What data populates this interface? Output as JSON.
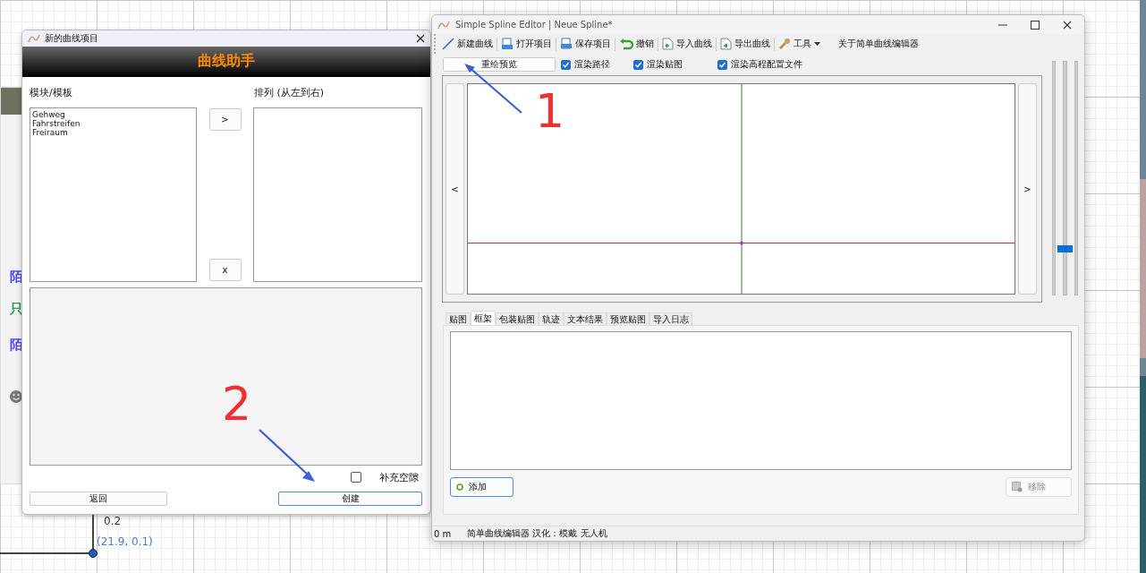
{
  "desktop": {
    "side_texts": [
      {
        "text": "陌",
        "color": "#4545f5"
      },
      {
        "text": "只",
        "color": "#2e9b5a"
      },
      {
        "text": "陌",
        "color": "#4545f5"
      }
    ],
    "axis_label": "0.2",
    "point_label": "(21.9, 0.1)"
  },
  "dialog": {
    "title": "新的曲线项目",
    "banner": "曲线助手",
    "modules_label": "模块/模板",
    "order_label": "排列 (从左到右)",
    "modules": [
      "Gehweg",
      "Fahrstreifen",
      "Freiraum"
    ],
    "add_button": ">",
    "remove_button": "x",
    "fill_gaps": {
      "label": "补充空隙",
      "checked": false
    },
    "buttons": [
      {
        "label": "返回",
        "selected": false
      },
      {
        "label": "创建",
        "selected": true
      }
    ]
  },
  "editor": {
    "title": "Simple Spline Editor | Neue Spline*",
    "toolbar": [
      {
        "label": "新建曲线",
        "kind": "line"
      },
      {
        "label": "打开项目",
        "kind": "open"
      },
      {
        "label": "保存项目",
        "kind": "save"
      },
      {
        "label": "撤销",
        "kind": "undo"
      },
      {
        "label": "导入曲线",
        "kind": "import"
      },
      {
        "label": "导出曲线",
        "kind": "export"
      },
      {
        "label": "工具",
        "kind": "wrench",
        "dropdown": true
      },
      {
        "label": "关于简单曲线编辑器",
        "kind": "plain"
      }
    ],
    "redraw_button": "重绘预览",
    "options": [
      {
        "label": "渲染路径",
        "checked": true
      },
      {
        "label": "渲染贴图",
        "checked": true
      },
      {
        "label": "渲染高程配置文件",
        "checked": true
      }
    ],
    "prev_button": "<",
    "next_button": ">",
    "zoom_slider": {
      "level": 0.18
    },
    "tabs": [
      {
        "label": "贴图",
        "selected": false
      },
      {
        "label": "框架",
        "selected": true
      },
      {
        "label": "包装贴图",
        "selected": false
      },
      {
        "label": "轨迹",
        "selected": false
      },
      {
        "label": "文本结果",
        "selected": false
      },
      {
        "label": "预览贴图",
        "selected": false
      },
      {
        "label": "导入日志",
        "selected": false
      }
    ],
    "add_button": "添加",
    "remove_button": {
      "label": "移除",
      "disabled": true
    },
    "status": [
      "0 m",
      "简单曲线编辑器 汉化：模戴 无人机"
    ]
  },
  "annotations": [
    {
      "label": "1"
    },
    {
      "label": "2"
    }
  ]
}
